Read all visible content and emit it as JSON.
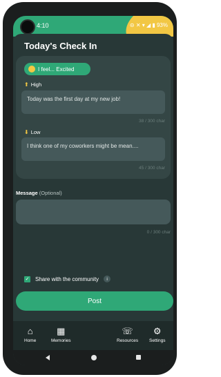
{
  "status": {
    "time": "4:10",
    "icons": "⊝ ✕ ▾ ◢ ▮ 93%"
  },
  "page": {
    "title": "Today's Check In"
  },
  "feeling": {
    "label": "I feel... Excited"
  },
  "high": {
    "label": "High",
    "text": "Today was the first day at my new job!",
    "count": "38 / 300 char"
  },
  "low": {
    "label": "Low",
    "text": "I think one of my coworkers might be mean....",
    "count": "45 / 300 char"
  },
  "message": {
    "label": "Message",
    "optional": "(Optional)",
    "value": "",
    "count": "0 / 300 char"
  },
  "share": {
    "label": "Share with the community",
    "checked": true
  },
  "post_button": "Post",
  "nav": [
    {
      "label": "Home",
      "icon": "home-icon"
    },
    {
      "label": "Memories",
      "icon": "calendar-icon"
    },
    {
      "label": "Resources",
      "icon": "phone-icon"
    },
    {
      "label": "Settings",
      "icon": "gear-icon"
    }
  ],
  "colors": {
    "accent": "#2fa877",
    "background": "#283837",
    "card": "#344645",
    "highlight": "#f2c744"
  }
}
